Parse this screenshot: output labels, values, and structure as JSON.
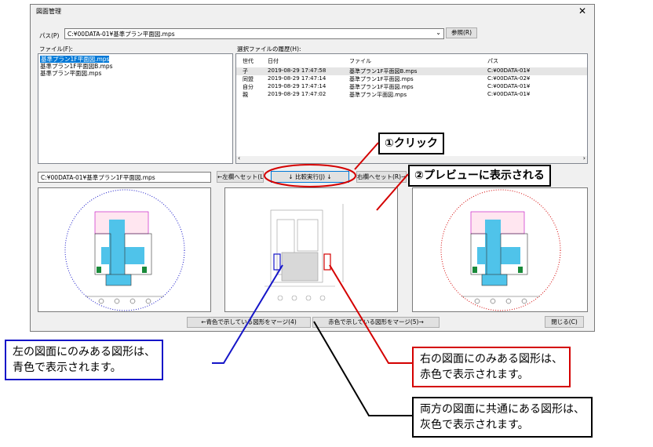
{
  "window": {
    "title": "図面管理",
    "close_glyph": "✕"
  },
  "path": {
    "label": "パス(P)",
    "value": "C:¥00DATA-01¥基準プラン平面図.mps",
    "browse_label": "参照(R)"
  },
  "files": {
    "label": "ファイル(F):",
    "items": [
      "基準プラン1F平面図.mps",
      "基準プラン1F平面図B.mps",
      "基準プラン平面図.mps"
    ],
    "selected_index": 0
  },
  "history": {
    "label": "選択ファイルの履歴(H):",
    "columns": [
      "世代",
      "日付",
      "ファイル",
      "パス"
    ],
    "rows": [
      [
        "子",
        "2019-08-29 17:47:58",
        "基準プラン1F平面図B.mps",
        "C:¥00DATA-01¥"
      ],
      [
        "同盟",
        "2019-08-29 17:47:14",
        "基準プラン1F平面図.mps",
        "C:¥00DATA-02¥"
      ],
      [
        "自分",
        "2019-08-29 17:47:14",
        "基準プラン1F平面図.mps",
        "C:¥00DATA-01¥"
      ],
      [
        "親",
        "2019-08-29 17:47:02",
        "基準プラン平面図.mps",
        "C:¥00DATA-01¥"
      ]
    ]
  },
  "compare": {
    "left_path": "C:¥00DATA-01¥基準プラン1F平面図.mps",
    "to_left_label": "←左欄へセット(L)",
    "run_label": "↓ 比較実行(J) ↓",
    "to_right_label": "右欄へセット(R)→"
  },
  "merge": {
    "blue_label": "←青色で示している図形をマージ(4)",
    "red_label": "赤色で示している図形をマージ(5)→",
    "close_label": "閉じる(C)"
  },
  "annotations": {
    "click": "①クリック",
    "preview": "②プレビューに表示される"
  },
  "callouts": {
    "blue": [
      "左の図面にのみある図形は、",
      "青色で表示されます。"
    ],
    "red": [
      "右の図面にのみある図形は、",
      "赤色で表示されます。"
    ],
    "gray": [
      "両方の図面に共通にある図形は、",
      "灰色で表示されます。"
    ]
  },
  "colors": {
    "blue": "#1515c8",
    "red": "#d40000",
    "gray": "#9a9a9a",
    "selection": "#0078d7",
    "cyan": "#4fc3ea"
  }
}
